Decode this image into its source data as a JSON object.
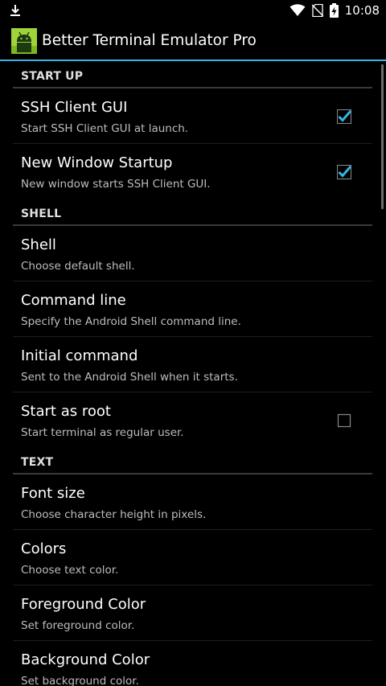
{
  "status_bar": {
    "time": "10:08",
    "battery_text": ""
  },
  "action_bar": {
    "title": "Better Terminal Emulator Pro",
    "icon": "android-app-icon"
  },
  "sections": [
    {
      "title": "START UP",
      "items": [
        {
          "title": "SSH Client GUI",
          "summary": "Start SSH Client GUI at launch.",
          "checkbox": true,
          "checked": true
        },
        {
          "title": "New Window Startup",
          "summary": "New window starts SSH Client GUI.",
          "checkbox": true,
          "checked": true
        }
      ]
    },
    {
      "title": "SHELL",
      "items": [
        {
          "title": "Shell",
          "summary": "Choose default shell.",
          "checkbox": false
        },
        {
          "title": "Command line",
          "summary": "Specify the Android Shell command line.",
          "checkbox": false
        },
        {
          "title": "Initial command",
          "summary": "Sent to the Android Shell when it starts.",
          "checkbox": false
        },
        {
          "title": "Start as root",
          "summary": "Start terminal as regular user.",
          "checkbox": true,
          "checked": false
        }
      ]
    },
    {
      "title": "TEXT",
      "items": [
        {
          "title": "Font size",
          "summary": "Choose character height in pixels.",
          "checkbox": false
        },
        {
          "title": "Colors",
          "summary": "Choose text color.",
          "checkbox": false
        },
        {
          "title": "Foreground Color",
          "summary": "Set foreground color.",
          "checkbox": false
        },
        {
          "title": "Background Color",
          "summary": "Set background color.",
          "checkbox": false
        }
      ]
    }
  ],
  "colors": {
    "accent": "#33b5e5",
    "background": "#000000",
    "summary_text": "#bdbdbd"
  }
}
